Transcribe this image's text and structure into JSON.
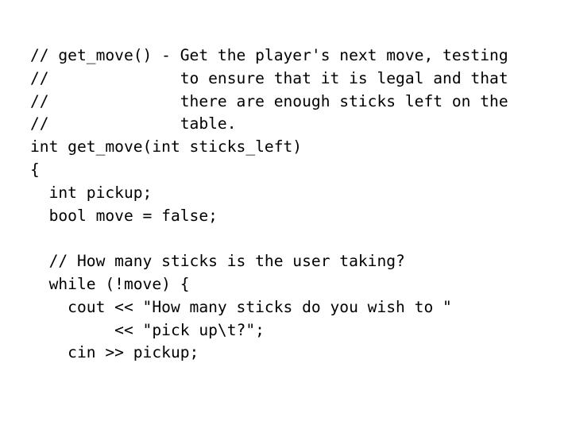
{
  "slide": {
    "background_color": "#ffffff",
    "text_color": "#000000",
    "language": "cpp",
    "font_kind": "monospace"
  },
  "code": {
    "lines": [
      "// get_move() - Get the player's next move, testing",
      "//              to ensure that it is legal and that",
      "//              there are enough sticks left on the",
      "//              table.",
      "int get_move(int sticks_left)",
      "{",
      "  int pickup;",
      "  bool move = false;",
      "",
      "  // How many sticks is the user taking?",
      "  while (!move) {",
      "    cout << \"How many sticks do you wish to \"",
      "         << \"pick up\\t?\";",
      "    cin >> pickup;"
    ]
  }
}
